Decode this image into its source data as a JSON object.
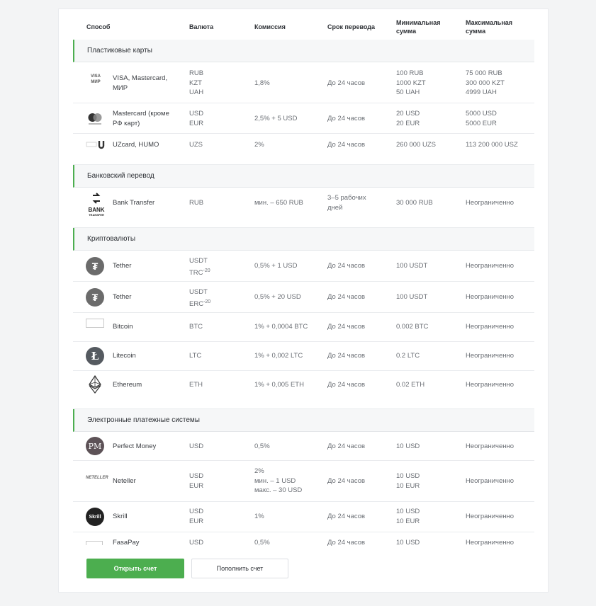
{
  "headers": {
    "method": "Способ",
    "currency": "Валюта",
    "fee": "Комиссия",
    "term": "Срок перевода",
    "min": "Минимальная\nсумма",
    "max": "Максимальная\nсумма"
  },
  "sections": {
    "cards": "Пластиковые карты",
    "bank": "Банковский перевод",
    "crypto": "Криптовалюты",
    "epay": "Электронные платежные системы"
  },
  "rows": [
    {
      "name": "VISA, Mastercard,\nМИР",
      "currency": "RUB\nKZT\nUAH",
      "fee": "1,8%",
      "term": "До 24 часов",
      "min": "100 RUB\n1000 KZT\n50 UAH",
      "max": "75 000 RUB\n300 000 KZT\n4999 UAH",
      "logo": "visa-mir-logo"
    },
    {
      "name": "Mastercard (кроме\nРФ карт)",
      "currency": "USD\nEUR",
      "fee": "2,5% + 5 USD",
      "term": "До 24 часов",
      "min": "20 USD\n20 EUR",
      "max": "5000 USD\n5000 EUR",
      "logo": "mastercard-logo"
    },
    {
      "name": "UZcard, HUMO",
      "currency": "UZS",
      "fee": "2%",
      "term": "До 24 часов",
      "min": "260 000 UZS",
      "max": "113 200 000 USZ",
      "logo": "uzcard-humo-logo"
    },
    {
      "name": "Bank Transfer",
      "currency": "RUB",
      "fee": "мин. – 650 RUB",
      "term": "3–5 рабочих\nдней",
      "min": "30 000 RUB",
      "max": "Неограниченно",
      "logo": "bank-transfer-logo"
    },
    {
      "name": "Tether",
      "currency": "USDT\nTRC",
      "currency_sup": "-20",
      "fee": "0,5% + 1 USD",
      "term": "До 24 часов",
      "min": "100 USDT",
      "max": "Неограниченно",
      "logo": "tether-icon"
    },
    {
      "name": "Tether",
      "currency": "USDT\nERC",
      "currency_sup": "-20",
      "fee": "0,5% + 20 USD",
      "term": "До 24 часов",
      "min": "100 USDT",
      "max": "Неограниченно",
      "logo": "tether-icon"
    },
    {
      "name": "Bitcoin",
      "currency": "BTC",
      "fee": "1% + 0,0004 BTC",
      "term": "До 24 часов",
      "min": "0.002 BTC",
      "max": "Неограниченно",
      "logo": "bitcoin-logo-broken"
    },
    {
      "name": "Litecoin",
      "currency": "LTC",
      "fee": "1% + 0,002 LTC",
      "term": "До 24 часов",
      "min": "0.2 LTC",
      "max": "Неограниченно",
      "logo": "litecoin-icon"
    },
    {
      "name": "Ethereum",
      "currency": "ETH",
      "fee": "1% + 0,005 ETH",
      "term": "До 24 часов",
      "min": "0.02 ETH",
      "max": "Неограниченно",
      "logo": "ethereum-icon"
    },
    {
      "name": "Perfect Money",
      "currency": "USD",
      "fee": "0,5%",
      "term": "До 24 часов",
      "min": "10 USD",
      "max": "Неограниченно",
      "logo": "perfect-money-icon",
      "logo_text": "PM"
    },
    {
      "name": "Neteller",
      "currency": "USD\nEUR",
      "fee": "2%\nмин. – 1 USD\nмакс. – 30 USD",
      "term": "До 24 часов",
      "min": "10 USD\n10 EUR",
      "max": "Неограниченно",
      "logo": "neteller-logo",
      "logo_text": "NETELLER"
    },
    {
      "name": "Skrill",
      "currency": "USD\nEUR",
      "fee": "1%",
      "term": "До 24 часов",
      "min": "10 USD\n10 EUR",
      "max": "Неограниченно",
      "logo": "skrill-icon",
      "logo_text": "Skrill"
    },
    {
      "name": "FasaPay",
      "currency": "USD",
      "fee": "0,5%",
      "term": "До 24 часов",
      "min": "10 USD",
      "max": "Неограниченно",
      "logo": "fasapay-logo-broken"
    }
  ],
  "logo_texts": {
    "visa": "VISA",
    "mir": "МИР",
    "bank_big": "BANK",
    "bank_small": "TRANSFER"
  },
  "buttons": {
    "open_account": "Открыть счет",
    "top_up": "Пополнить счет"
  },
  "colors": {
    "accent": "#4cae4f",
    "section_bg": "#f6f7f8"
  }
}
